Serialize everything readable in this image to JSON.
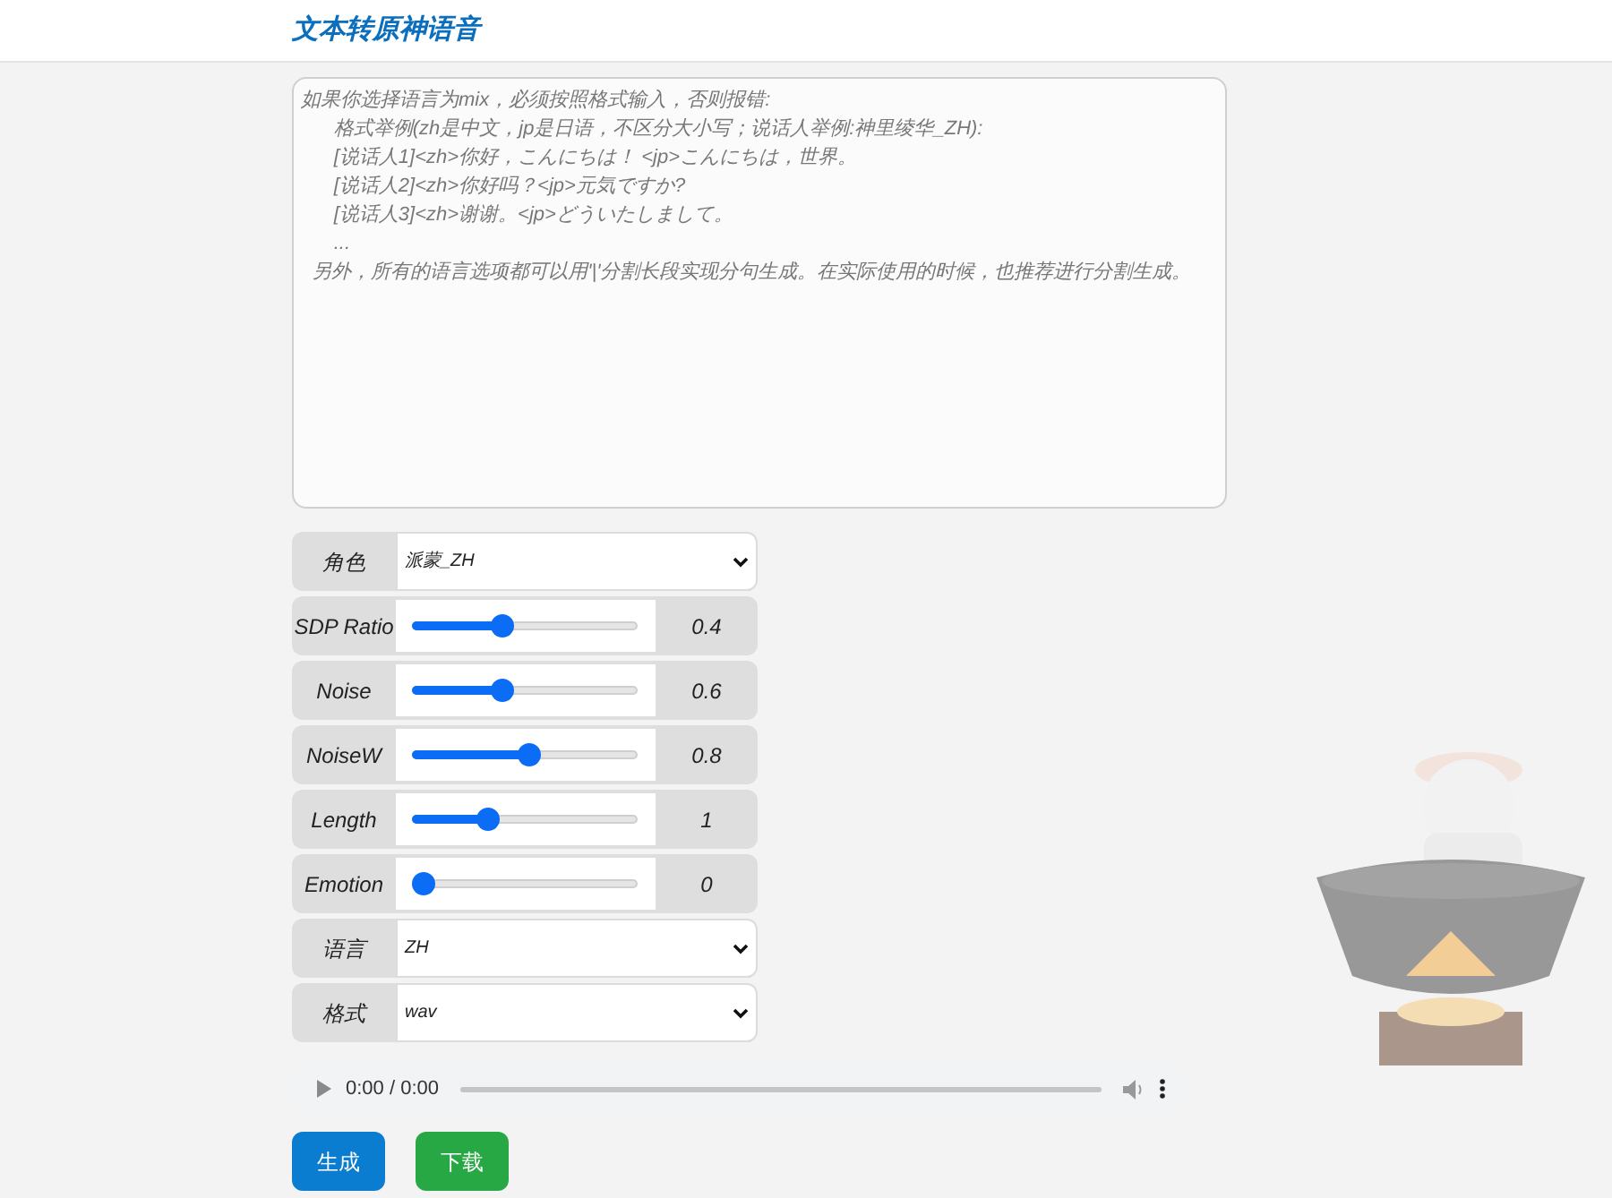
{
  "header": {
    "title": "文本转原神语音"
  },
  "text_input": {
    "placeholder": "如果你选择语言为mix，必须按照格式输入，否则报错:\n      格式举例(zh是中文，jp是日语，不区分大小写；说话人举例:神里绫华_ZH):\n      [说话人1]<zh>你好，こんにちは！ <jp>こんにちは，世界。\n      [说话人2]<zh>你好吗？<jp>元気ですか?\n      [说话人3]<zh>谢谢。<jp>どういたしまして。\n      ...\n  另外，所有的语言选项都可以用'|'分割长段实现分句生成。在实际使用的时候，也推荐进行分割生成。"
  },
  "controls": [
    {
      "kind": "select",
      "label": "角色",
      "value": "派蒙_ZH"
    },
    {
      "kind": "slider",
      "label": "SDP Ratio",
      "level": 0.4,
      "reading": "0.4"
    },
    {
      "kind": "slider",
      "label": "Noise",
      "level": 0.4,
      "reading": "0.6"
    },
    {
      "kind": "slider",
      "label": "NoiseW",
      "level": 0.52,
      "reading": "0.8"
    },
    {
      "kind": "slider",
      "label": "Length",
      "level": 0.34,
      "reading": "1"
    },
    {
      "kind": "slider",
      "label": "Emotion",
      "level": 0,
      "reading": "0"
    },
    {
      "kind": "select",
      "label": "语言",
      "value": "ZH"
    },
    {
      "kind": "select",
      "label": "格式",
      "value": "wav"
    }
  ],
  "audio_player": {
    "time": "0:00 / 0:00"
  },
  "buttons": [
    {
      "label": "生成",
      "color": "#0b7dd0"
    },
    {
      "label": "下载",
      "color": "#28a745"
    }
  ]
}
